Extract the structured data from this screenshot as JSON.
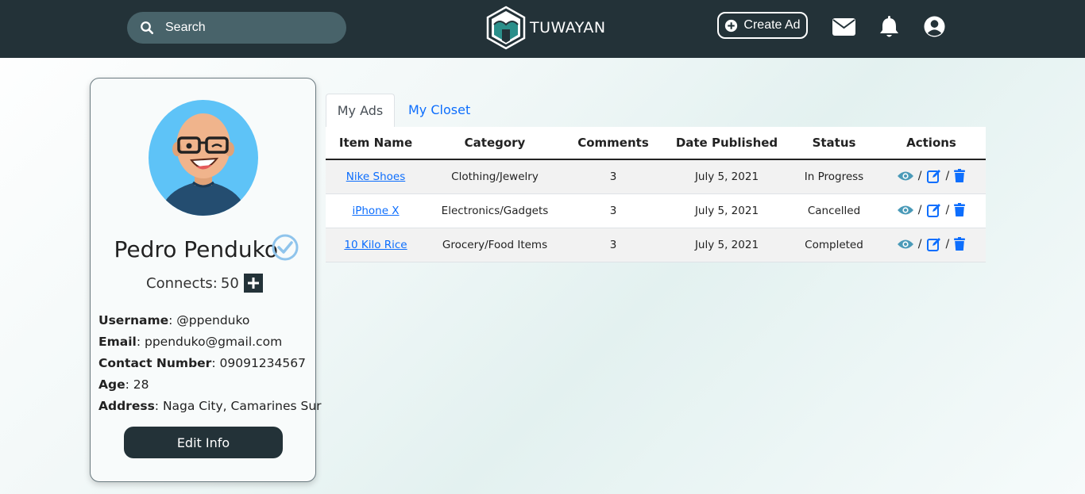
{
  "navbar": {
    "search_placeholder": "Search",
    "brand_name": "TUWAYAN",
    "create_ad_label": "Create Ad"
  },
  "profile": {
    "name": "Pedro Penduko",
    "connects_label": "Connects:",
    "connects_count": "50",
    "fields": [
      {
        "label": "Username",
        "value": ": @ppenduko"
      },
      {
        "label": "Email",
        "value": ": ppenduko@gmail.com"
      },
      {
        "label": "Contact Number",
        "value": ": 09091234567"
      },
      {
        "label": "Age",
        "value": ": 28"
      },
      {
        "label": "Address",
        "value": ": Naga City, Camarines Sur"
      }
    ],
    "edit_button": "Edit Info"
  },
  "tabs": [
    {
      "label": "My Ads",
      "active": true
    },
    {
      "label": "My Closet",
      "active": false
    }
  ],
  "table": {
    "headers": [
      "Item Name",
      "Category",
      "Comments",
      "Date Published",
      "Status",
      "Actions"
    ],
    "rows": [
      {
        "item": "Nike Shoes",
        "category": "Clothing/Jewelry",
        "comments": "3",
        "date": "July 5, 2021",
        "status": "In Progress"
      },
      {
        "item": "iPhone X",
        "category": "Electronics/Gadgets",
        "comments": "3",
        "date": "July 5, 2021",
        "status": "Cancelled"
      },
      {
        "item": "10 Kilo Rice",
        "category": "Grocery/Food Items",
        "comments": "3",
        "date": "July 5, 2021",
        "status": "Completed"
      }
    ],
    "action_separator": "/"
  },
  "colors": {
    "navbar": "#233238",
    "search_bg": "#48636a",
    "link": "#0d6efd",
    "eye": "#4a9ab8",
    "verified": "#8fc4ec",
    "avatar_bg": "#5ec3f7"
  },
  "icons": [
    "search-icon",
    "logo-icon",
    "plus-circle-icon",
    "envelope-icon",
    "bell-icon",
    "user-icon",
    "verified-check-icon",
    "plus-icon",
    "eye-icon",
    "edit-icon",
    "trash-icon"
  ]
}
